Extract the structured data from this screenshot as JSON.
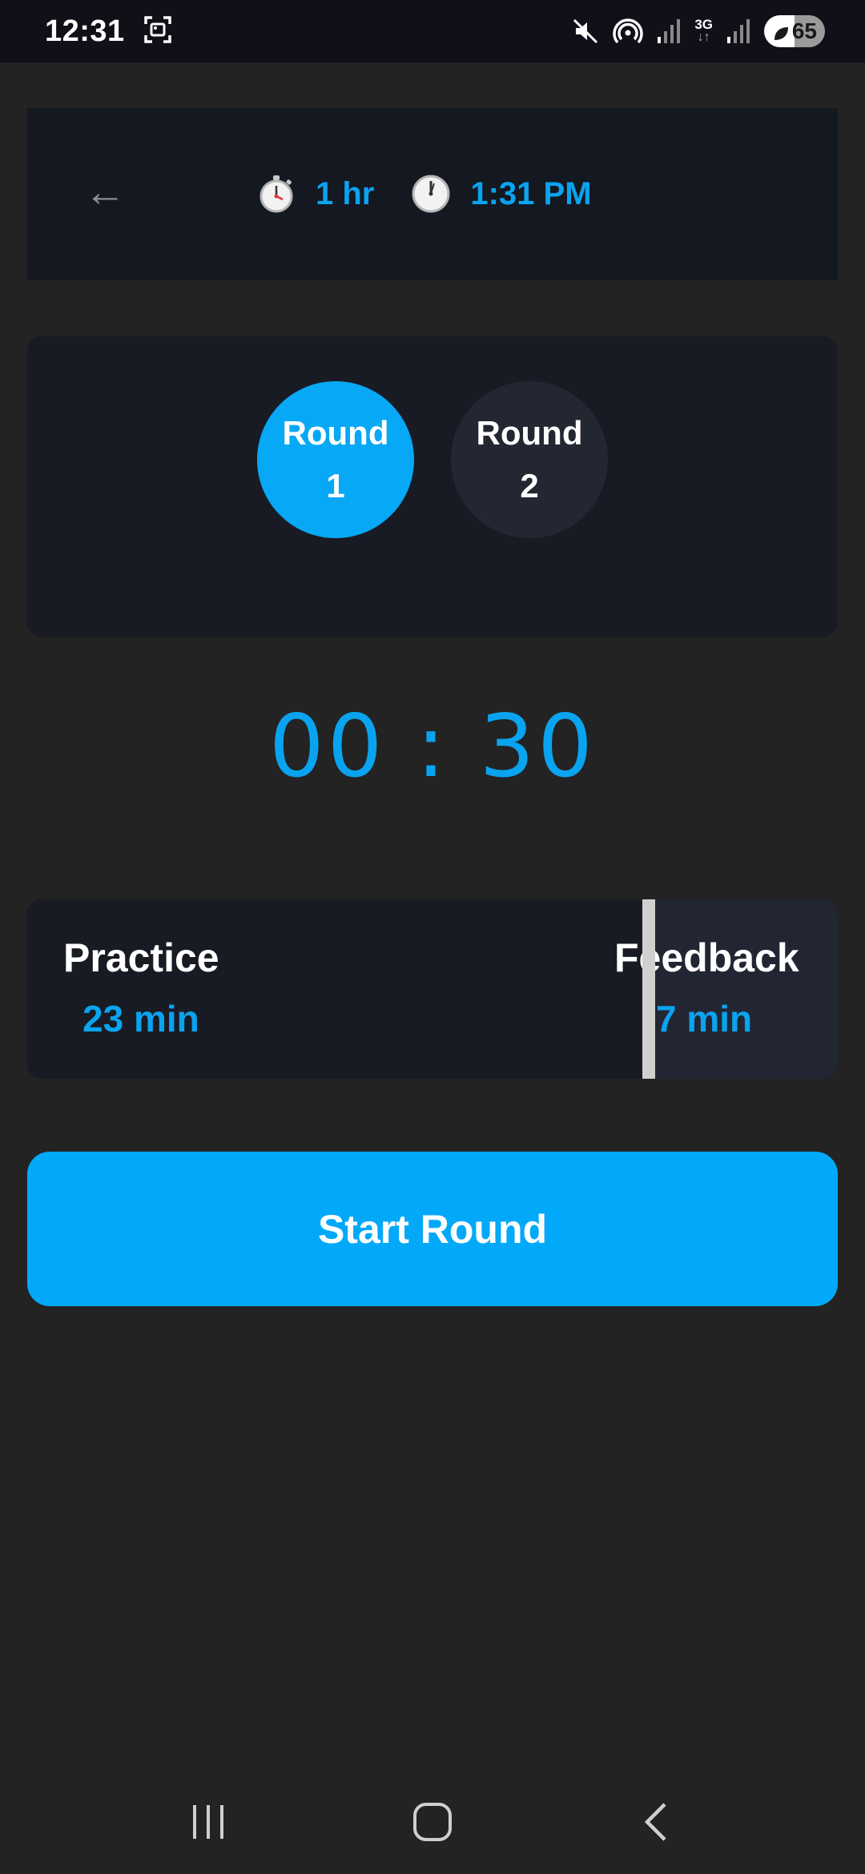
{
  "status_bar": {
    "time": "12:31",
    "network_label": "3G",
    "battery_level": "65"
  },
  "header": {
    "back_label": "←",
    "duration_icon": "stopwatch-icon",
    "duration_text": "1 hr",
    "end_time_icon": "clock-icon",
    "end_time_text": "1:31 PM"
  },
  "rounds": [
    {
      "label": "Round",
      "number": "1",
      "active": true
    },
    {
      "label": "Round",
      "number": "2",
      "active": false
    }
  ],
  "timer": {
    "value": "00 : 30"
  },
  "phases": {
    "practice": {
      "title": "Practice",
      "value": "23 min"
    },
    "feedback": {
      "title": "Feedback",
      "value": "7 min"
    }
  },
  "start_button": {
    "label": "Start Round"
  },
  "colors": {
    "accent": "#03a9f9",
    "background": "#232323",
    "card": "#181b24"
  }
}
